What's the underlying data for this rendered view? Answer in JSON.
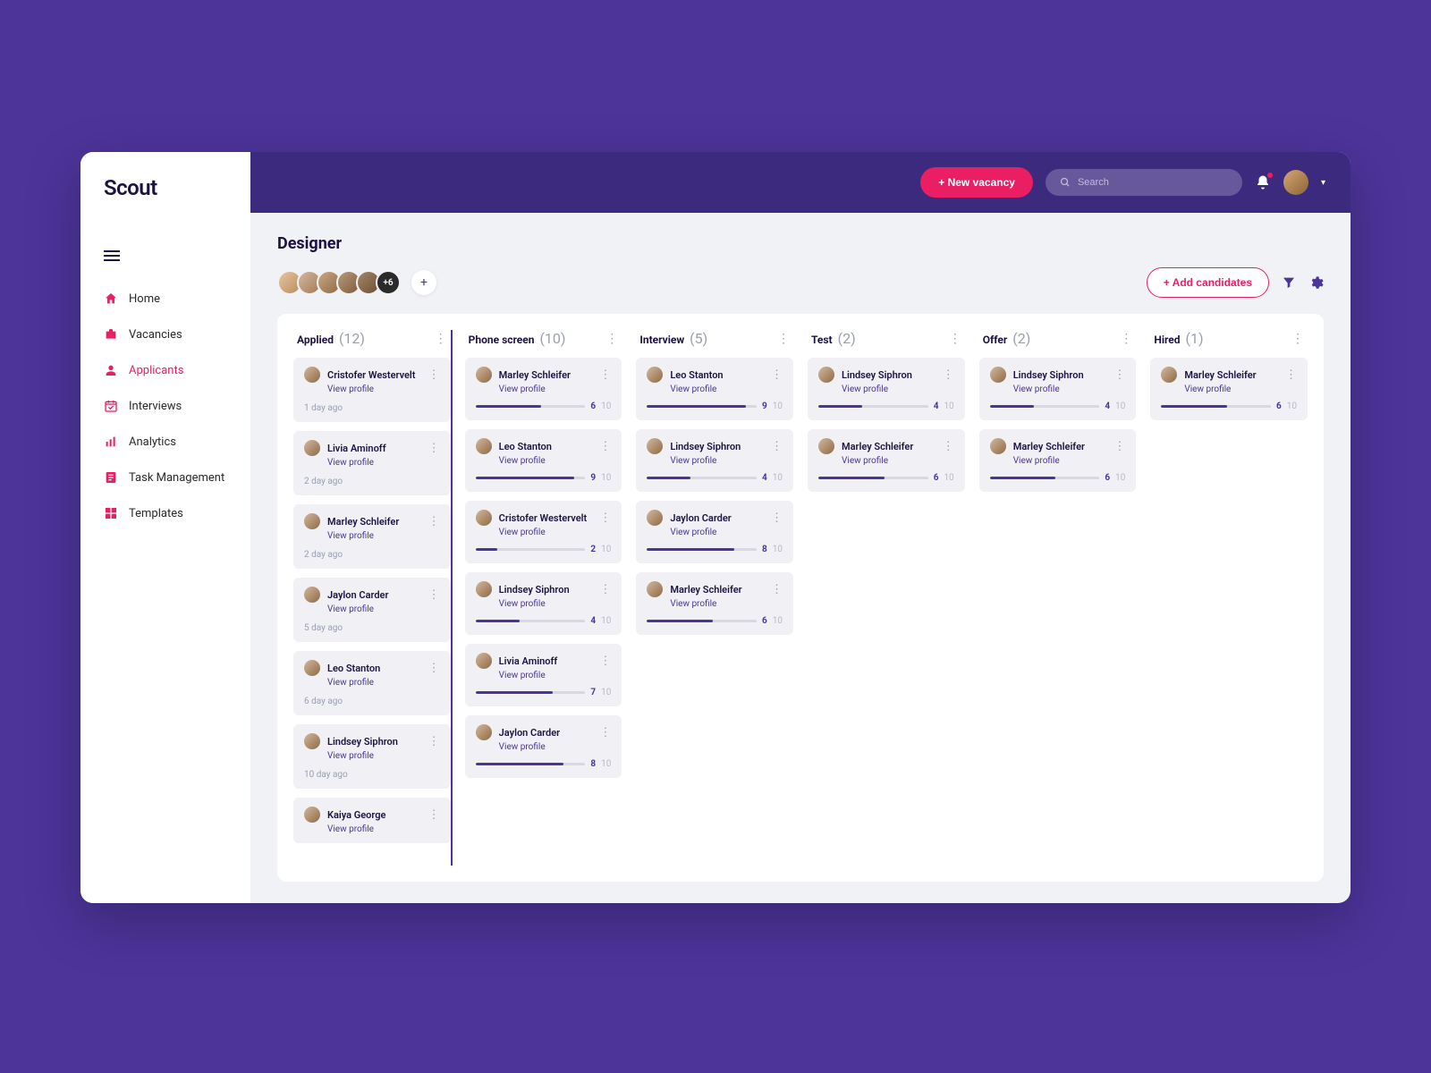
{
  "brand": "Scout",
  "topbar": {
    "new_vacancy": "+ New vacancy",
    "search_placeholder": "Search"
  },
  "sidebar": {
    "items": [
      {
        "label": "Home",
        "name": "home"
      },
      {
        "label": "Vacancies",
        "name": "vacancies"
      },
      {
        "label": "Applicants",
        "name": "applicants"
      },
      {
        "label": "Interviews",
        "name": "interviews"
      },
      {
        "label": "Analytics",
        "name": "analytics"
      },
      {
        "label": "Task Management",
        "name": "task-management"
      },
      {
        "label": "Templates",
        "name": "templates"
      }
    ],
    "active_index": 2
  },
  "page": {
    "title": "Designer",
    "avatar_overflow": "+6",
    "add_candidates": "+ Add candidates"
  },
  "view_profile_label": "View profile",
  "score_max": 10,
  "columns": [
    {
      "title": "Applied",
      "count": 12,
      "cards": [
        {
          "name": "Cristofer Westervelt",
          "timestamp": "1 day ago"
        },
        {
          "name": "Livia Aminoff",
          "timestamp": "2 day ago"
        },
        {
          "name": "Marley Schleifer",
          "timestamp": "2 day ago"
        },
        {
          "name": "Jaylon Carder",
          "timestamp": "5 day ago"
        },
        {
          "name": "Leo Stanton",
          "timestamp": "6 day ago"
        },
        {
          "name": "Lindsey Siphron",
          "timestamp": "10 day ago"
        },
        {
          "name": "Kaiya George",
          "timestamp": ""
        }
      ]
    },
    {
      "title": "Phone screen",
      "count": 10,
      "drag_target": true,
      "cards": [
        {
          "name": "Marley Schleifer",
          "score": 6
        },
        {
          "name": "Leo Stanton",
          "score": 9
        },
        {
          "name": "Cristofer Westervelt",
          "score": 2
        },
        {
          "name": "Lindsey Siphron",
          "score": 4
        },
        {
          "name": "Livia Aminoff",
          "score": 7
        },
        {
          "name": "Jaylon Carder",
          "score": 8
        }
      ]
    },
    {
      "title": "Interview",
      "count": 5,
      "cards": [
        {
          "name": "Leo Stanton",
          "score": 9
        },
        {
          "name": "Lindsey Siphron",
          "score": 4
        },
        {
          "name": "Jaylon Carder",
          "score": 8
        },
        {
          "name": "Marley Schleifer",
          "score": 6
        }
      ]
    },
    {
      "title": "Test",
      "count": 2,
      "cards": [
        {
          "name": "Lindsey Siphron",
          "score": 4
        },
        {
          "name": "Marley Schleifer",
          "score": 6
        }
      ]
    },
    {
      "title": "Offer",
      "count": 2,
      "cards": [
        {
          "name": "Lindsey Siphron",
          "score": 4
        },
        {
          "name": "Marley Schleifer",
          "score": 6
        }
      ]
    },
    {
      "title": "Hired",
      "count": 1,
      "cards": [
        {
          "name": "Marley Schleifer",
          "score": 6
        }
      ]
    }
  ]
}
